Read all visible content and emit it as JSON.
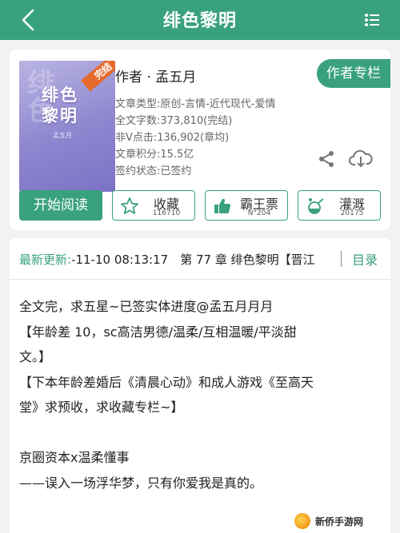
{
  "header": {
    "title": "绯色黎明",
    "back_icon": "chevron-left-icon",
    "menu_icon": "more-dots-icon"
  },
  "book": {
    "cover": {
      "title_line1": "绯色",
      "title_line2": "黎明",
      "subtitle": "孟五月",
      "badge": "完结"
    },
    "author_label": "作者 · 孟五月",
    "author_column_button": "作者专栏",
    "meta": [
      "文章类型:原创-言情-近代现代-爱情",
      "全文字数:373,810(完结)",
      "非V点击:136,902(章均)",
      "文章积分:15.5亿",
      "签约状态:已签约"
    ]
  },
  "actions": {
    "read": "开始阅读",
    "collect": {
      "label": "收藏",
      "count": "116710",
      "icon": "star-icon"
    },
    "vote": {
      "label": "霸王票",
      "count": "N°204",
      "icon": "thumbs-up-icon"
    },
    "water": {
      "label": "灌溉",
      "count": "20175",
      "icon": "watering-can-icon"
    }
  },
  "latest": {
    "label": "最新更新:",
    "text": "-11-10 08:13:17　第 77 章 绯色黎明【晋江",
    "directory": "目录"
  },
  "description": [
    "全文完，求五星~已签实体进度@孟五月月月",
    "【年龄差 10，sc高洁男德/温柔/互相温暖/平淡甜",
    "文。】",
    "【下本年龄差婚后《清晨心动》和成人游戏《至高天",
    "堂》求预收，求收藏专栏~】",
    "",
    "京圈资本x温柔懂事",
    "——误入一场浮华梦，只有你爱我是真的。"
  ],
  "watermark": "新侨手游网",
  "colors": {
    "accent": "#3aa17e",
    "badge": "#e66a2c"
  }
}
